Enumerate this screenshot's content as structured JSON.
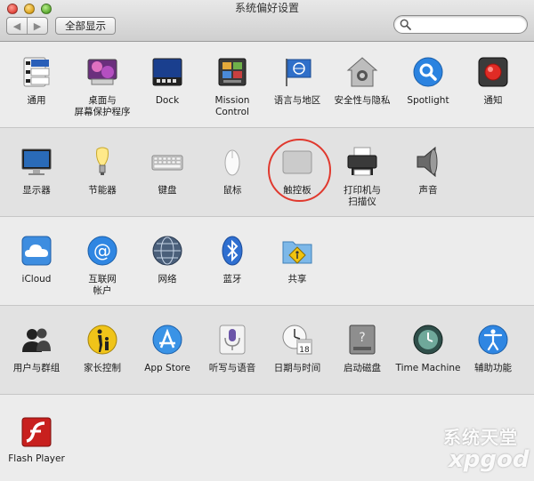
{
  "window": {
    "title": "系统偏好设置"
  },
  "toolbar": {
    "back": "◀",
    "forward": "▶",
    "show_all": "全部显示"
  },
  "search": {
    "value": "",
    "placeholder": ""
  },
  "sections": [
    {
      "items": [
        {
          "label": "通用",
          "icon": "file-settings-icon"
        },
        {
          "label": "桌面与\n屏幕保护程序",
          "icon": "desktop-icon"
        },
        {
          "label": "Dock",
          "icon": "dock-icon"
        },
        {
          "label": "Mission\nControl",
          "icon": "mission-control-icon"
        },
        {
          "label": "语言与地区",
          "icon": "language-flag-icon"
        },
        {
          "label": "安全性与隐私",
          "icon": "house-lock-icon"
        },
        {
          "label": "Spotlight",
          "icon": "magnifier-icon"
        },
        {
          "label": "通知",
          "icon": "notifications-icon"
        }
      ]
    },
    {
      "items": [
        {
          "label": "显示器",
          "icon": "display-icon"
        },
        {
          "label": "节能器",
          "icon": "bulb-icon"
        },
        {
          "label": "键盘",
          "icon": "keyboard-icon"
        },
        {
          "label": "鼠标",
          "icon": "mouse-icon"
        },
        {
          "label": "触控板",
          "icon": "trackpad-icon"
        },
        {
          "label": "打印机与\n扫描仪",
          "icon": "printer-icon"
        },
        {
          "label": "声音",
          "icon": "speaker-icon"
        }
      ]
    },
    {
      "items": [
        {
          "label": "iCloud",
          "icon": "cloud-icon"
        },
        {
          "label": "互联网\n帐户",
          "icon": "at-icon"
        },
        {
          "label": "网络",
          "icon": "globe-icon"
        },
        {
          "label": "蓝牙",
          "icon": "bluetooth-icon"
        },
        {
          "label": "共享",
          "icon": "shared-folder-icon"
        }
      ]
    },
    {
      "items": [
        {
          "label": "用户与群组",
          "icon": "users-icon"
        },
        {
          "label": "家长控制",
          "icon": "parental-icon"
        },
        {
          "label": "App Store",
          "icon": "app-store-icon"
        },
        {
          "label": "听写与语音",
          "icon": "microphone-icon"
        },
        {
          "label": "日期与时间",
          "icon": "clock-calendar-icon"
        },
        {
          "label": "启动磁盘",
          "icon": "disk-icon"
        },
        {
          "label": "Time Machine",
          "icon": "time-machine-icon"
        },
        {
          "label": "辅助功能",
          "icon": "accessibility-icon"
        }
      ]
    },
    {
      "items": [
        {
          "label": "Flash Player",
          "icon": "flash-icon"
        }
      ]
    }
  ],
  "calendar_badge": "18",
  "watermark": {
    "line1": "系统天堂",
    "line2": "xpgod"
  }
}
